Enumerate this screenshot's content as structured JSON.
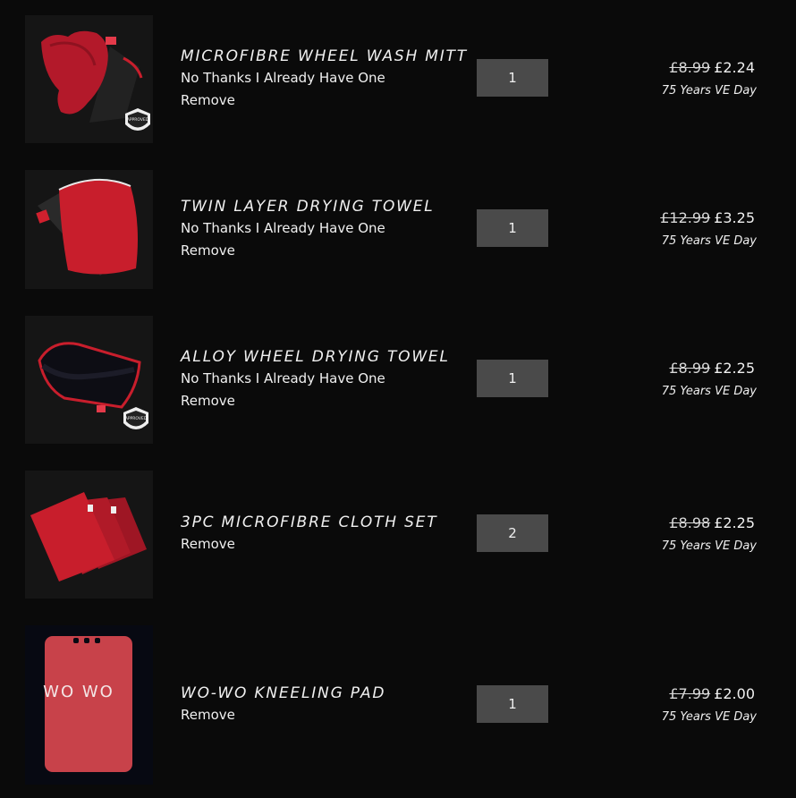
{
  "colors": {
    "background": "#0a0a0a",
    "quantity_box": "#4a4a4a",
    "product_red": "#c81e2c"
  },
  "cart_items": [
    {
      "name": "MICROFIBRE WHEEL WASH MITT",
      "decline_label": "No Thanks I Already Have One",
      "remove_label": "Remove",
      "quantity": "1",
      "old_price": "£8.99",
      "price": "£2.24",
      "promo": "75 Years VE Day",
      "badge_text": "APPROVED",
      "image_icon": "wash-mitt-image"
    },
    {
      "name": "TWIN LAYER DRYING TOWEL",
      "decline_label": "No Thanks I Already Have One",
      "remove_label": "Remove",
      "quantity": "1",
      "old_price": "£12.99",
      "price": "£3.25",
      "promo": "75 Years VE Day",
      "image_icon": "drying-towel-image"
    },
    {
      "name": "ALLOY WHEEL DRYING TOWEL",
      "decline_label": "No Thanks I Already Have One",
      "remove_label": "Remove",
      "quantity": "1",
      "old_price": "£8.99",
      "price": "£2.25",
      "promo": "75 Years VE Day",
      "badge_text": "APPROVED",
      "image_icon": "alloy-towel-image"
    },
    {
      "name": "3PC MICROFIBRE CLOTH SET",
      "remove_label": "Remove",
      "quantity": "2",
      "old_price": "£8.98",
      "price": "£2.25",
      "promo": "75 Years VE Day",
      "image_icon": "cloth-set-image"
    },
    {
      "name": "WO-WO KNEELING PAD",
      "remove_label": "Remove",
      "quantity": "1",
      "old_price": "£7.99",
      "price": "£2.00",
      "promo": "75 Years VE Day",
      "logo_text": "WO WO",
      "image_icon": "kneeling-pad-image"
    }
  ]
}
